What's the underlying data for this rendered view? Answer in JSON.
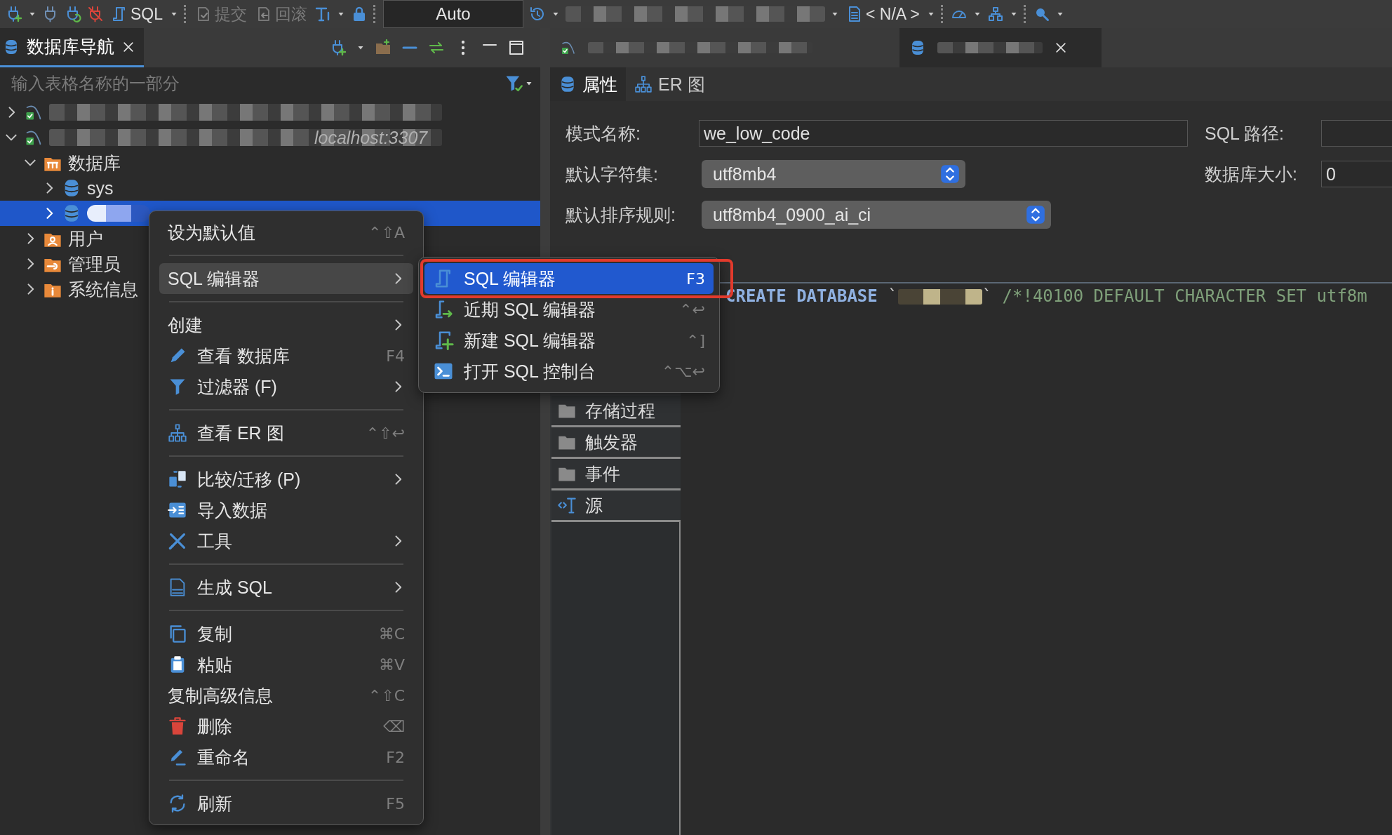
{
  "toolbar": {
    "sql_label": "SQL",
    "commit": {
      "label": "提交",
      "disabled": true
    },
    "rollback": {
      "label": "回滚",
      "disabled": true
    },
    "transaction_mode": "Auto",
    "datasource": "< N/A >"
  },
  "navigator": {
    "tab": {
      "label": "数据库导航",
      "selected": true
    },
    "filter": {
      "placeholder": "输入表格名称的一部分"
    },
    "tree": [
      {
        "kind": "connection",
        "redacted": true,
        "expanded": false,
        "selected": false
      },
      {
        "kind": "connection",
        "redacted": true,
        "host": "localhost:3307",
        "expanded": true,
        "selected": false,
        "children": [
          {
            "kind": "databases",
            "label": "数据库",
            "expanded": true,
            "selected": false,
            "children": [
              {
                "kind": "schema",
                "label": "sys",
                "expanded": false,
                "selected": false
              },
              {
                "kind": "schema",
                "redacted": true,
                "expanded": false,
                "selected": true
              }
            ]
          },
          {
            "kind": "users",
            "label": "用户",
            "expanded": false,
            "selected": false
          },
          {
            "kind": "admin",
            "label": "管理员",
            "expanded": false,
            "selected": false
          },
          {
            "kind": "info",
            "label": "系统信息",
            "expanded": false,
            "selected": false
          }
        ]
      }
    ]
  },
  "context_menu": {
    "items": [
      {
        "kind": "item",
        "label": "设为默认值",
        "shortcut": "⌃⇧A",
        "submenu": false,
        "selected": false
      },
      {
        "kind": "separator"
      },
      {
        "kind": "item",
        "label": "SQL 编辑器",
        "submenu": true,
        "selected": true
      },
      {
        "kind": "separator"
      },
      {
        "kind": "item",
        "label": "创建",
        "submenu": true,
        "selected": false
      },
      {
        "kind": "item",
        "label": "查看 数据库",
        "shortcut": "F4",
        "submenu": false,
        "selected": false
      },
      {
        "kind": "item",
        "label": "过滤器 (F)",
        "submenu": true,
        "selected": false
      },
      {
        "kind": "separator"
      },
      {
        "kind": "item",
        "label": "查看 ER 图",
        "shortcut": "⌃⇧↩",
        "submenu": false,
        "selected": false
      },
      {
        "kind": "separator"
      },
      {
        "kind": "item",
        "label": "比较/迁移 (P)",
        "submenu": true,
        "selected": false
      },
      {
        "kind": "item",
        "label": "导入数据",
        "submenu": false,
        "selected": false
      },
      {
        "kind": "item",
        "label": "工具",
        "submenu": true,
        "selected": false
      },
      {
        "kind": "separator"
      },
      {
        "kind": "item",
        "label": "生成 SQL",
        "submenu": true,
        "selected": false
      },
      {
        "kind": "separator"
      },
      {
        "kind": "item",
        "label": "复制",
        "shortcut": "⌘C",
        "submenu": false,
        "selected": false
      },
      {
        "kind": "item",
        "label": "粘贴",
        "shortcut": "⌘V",
        "submenu": false,
        "selected": false
      },
      {
        "kind": "item",
        "label": "复制高级信息",
        "shortcut": "⌃⇧C",
        "submenu": false,
        "selected": false
      },
      {
        "kind": "item",
        "label": "删除",
        "shortcut": "⌫",
        "submenu": false,
        "selected": false
      },
      {
        "kind": "item",
        "label": "重命名",
        "shortcut": "F2",
        "submenu": false,
        "selected": false
      },
      {
        "kind": "separator"
      },
      {
        "kind": "item",
        "label": "刷新",
        "shortcut": "F5",
        "submenu": false,
        "selected": false
      }
    ]
  },
  "submenu": {
    "items": [
      {
        "label": "SQL 编辑器",
        "shortcut": "F3",
        "selected": true,
        "outlined": true
      },
      {
        "label": "近期 SQL 编辑器",
        "shortcut": "⌃↩",
        "selected": false,
        "outlined": false
      },
      {
        "label": "新建 SQL 编辑器",
        "shortcut": "⌃]",
        "selected": false,
        "outlined": false
      },
      {
        "label": "打开 SQL 控制台",
        "shortcut": "⌃⌥↩",
        "selected": false,
        "outlined": false
      }
    ]
  },
  "editor": {
    "tabs": [
      {
        "redacted": true,
        "selected": false
      },
      {
        "redacted": true,
        "selected": true
      }
    ],
    "subtabs": [
      {
        "label": "属性",
        "selected": true
      },
      {
        "label": "ER 图",
        "selected": false
      }
    ],
    "properties_left": [
      {
        "label": "模式名称:",
        "value": "we_low_code",
        "kind": "text"
      },
      {
        "label": "默认字符集:",
        "value": "utf8mb4",
        "kind": "select"
      },
      {
        "label": "默认排序规则:",
        "value": "utf8mb4_0900_ai_ci",
        "kind": "select"
      }
    ],
    "properties_right": [
      {
        "label": "SQL 路径:",
        "kind": "text"
      },
      {
        "label": "数据库大小:",
        "value": "0",
        "kind": "text"
      }
    ],
    "folders": [
      {
        "label": "存储过程",
        "kind": "folder",
        "selected": false
      },
      {
        "label": "触发器",
        "kind": "folder",
        "selected": false
      },
      {
        "label": "事件",
        "kind": "folder",
        "selected": false
      },
      {
        "label": "源",
        "kind": "source",
        "selected": false
      }
    ],
    "sql": [
      {
        "kind": "keyword",
        "text": "CREATE DATABASE"
      },
      {
        "kind": "plain",
        "text": " `"
      },
      {
        "kind": "redacted"
      },
      {
        "kind": "plain",
        "text": "` "
      },
      {
        "kind": "comment",
        "text": "/*!40100 DEFAULT CHARACTER SET utf8m"
      }
    ]
  }
}
